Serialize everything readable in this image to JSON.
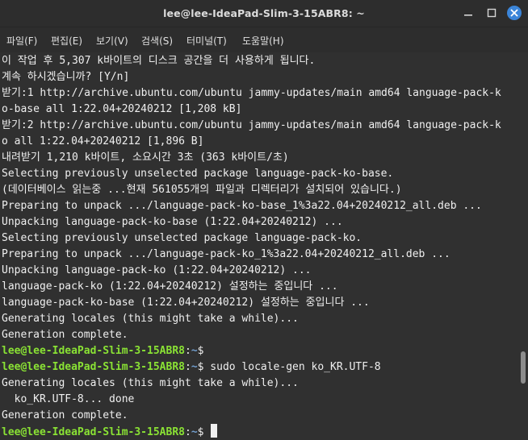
{
  "window": {
    "title": "lee@lee-IdeaPad-Slim-3-15ABR8: ~"
  },
  "menu": [
    {
      "label": "파일(F)"
    },
    {
      "label": "편집(E)"
    },
    {
      "label": "보기(V)"
    },
    {
      "label": "검색(S)"
    },
    {
      "label": "터미널(T)"
    },
    {
      "label": "도움말(H)"
    }
  ],
  "prompt": {
    "user_host": "lee@lee-IdeaPad-Slim-3-15ABR8",
    "separator": ":",
    "path": "~",
    "symbol": "$"
  },
  "lines": [
    {
      "text": "이 작업 후 5,307 k바이트의 디스크 공간을 더 사용하게 됩니다."
    },
    {
      "text": "계속 하시겠습니까? [Y/n]"
    },
    {
      "text": "받기:1 http://archive.ubuntu.com/ubuntu jammy-updates/main amd64 language-pack-k"
    },
    {
      "text": "o-base all 1:22.04+20240212 [1,208 kB]"
    },
    {
      "text": "받기:2 http://archive.ubuntu.com/ubuntu jammy-updates/main amd64 language-pack-k"
    },
    {
      "text": "o all 1:22.04+20240212 [1,896 B]"
    },
    {
      "text": "내려받기 1,210 k바이트, 소요시간 3초 (363 k바이트/초)"
    },
    {
      "text": "Selecting previously unselected package language-pack-ko-base."
    },
    {
      "text": "(데이터베이스 읽는중 ...현재 561055개의 파일과 디렉터리가 설치되어 있습니다.)"
    },
    {
      "text": "Preparing to unpack .../language-pack-ko-base_1%3a22.04+20240212_all.deb ..."
    },
    {
      "text": "Unpacking language-pack-ko-base (1:22.04+20240212) ..."
    },
    {
      "text": "Selecting previously unselected package language-pack-ko."
    },
    {
      "text": "Preparing to unpack .../language-pack-ko_1%3a22.04+20240212_all.deb ..."
    },
    {
      "text": "Unpacking language-pack-ko (1:22.04+20240212) ..."
    },
    {
      "text": "language-pack-ko (1:22.04+20240212) 설정하는 중입니다 ..."
    },
    {
      "text": "language-pack-ko-base (1:22.04+20240212) 설정하는 중입니다 ..."
    },
    {
      "text": "Generating locales (this might take a while)..."
    },
    {
      "text": "Generation complete."
    },
    {
      "prompt": true,
      "command": ""
    },
    {
      "prompt": true,
      "command": " sudo locale-gen ko_KR.UTF-8"
    },
    {
      "text": "Generating locales (this might take a while)..."
    },
    {
      "text": "  ko_KR.UTF-8... done"
    },
    {
      "text": "Generation complete."
    },
    {
      "prompt": true,
      "command": " ",
      "cursor": true
    }
  ],
  "colors": {
    "prompt_user": "#8ae234",
    "prompt_path": "#729fcf",
    "close_button": "#3b85d9",
    "terminal_bg": "#303030"
  },
  "icons": {
    "minimize": "minimize-icon",
    "maximize": "maximize-icon",
    "close": "close-icon"
  }
}
